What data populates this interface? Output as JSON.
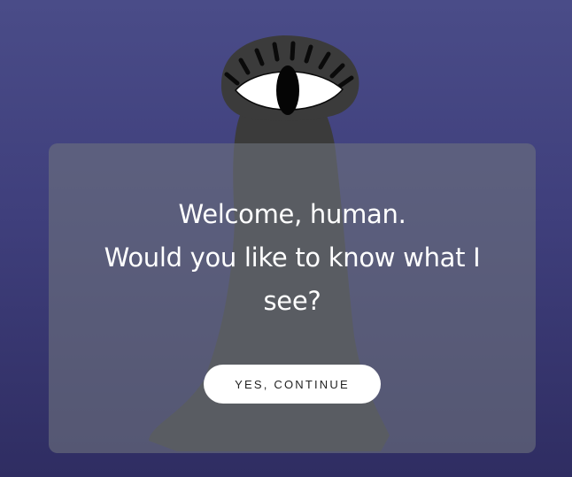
{
  "dialog": {
    "greeting": "Welcome, human.",
    "question": "Would you like to know what I see?",
    "continue_label": "YES, CONTINUE"
  },
  "colors": {
    "background_top": "#4a4c88",
    "background_bottom": "#2f2d62",
    "creature_body": "#3b3b3b",
    "eye_white": "#ffffff",
    "button_bg": "#ffffff"
  }
}
